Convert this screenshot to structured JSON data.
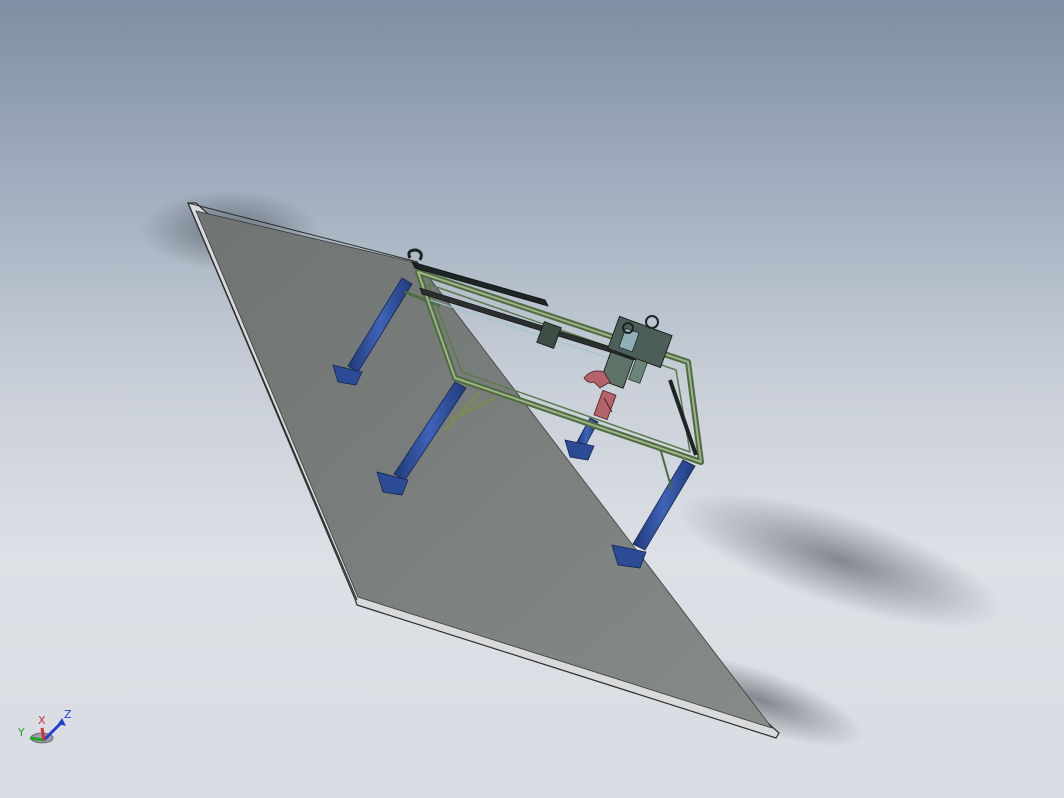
{
  "viewport": {
    "background_top": "#7f8ea4",
    "background_bottom": "#d9dde3"
  },
  "model": {
    "colors": {
      "base_plate": "#7c817e",
      "frame": "#6f8a60",
      "legs": "#2f4f9a",
      "rail": "#2a2f30",
      "gripper": "#b4636a"
    }
  },
  "triad": {
    "x_label": "X",
    "y_label": "Y",
    "z_label": "Z",
    "x_color": "#d03030",
    "y_color": "#2aa02a",
    "z_color": "#2040d0"
  }
}
